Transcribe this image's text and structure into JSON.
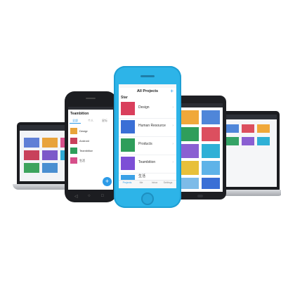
{
  "phone": {
    "nav_title": "All Projects",
    "add_icon": "plus-icon",
    "section": "Star",
    "projects": [
      {
        "label": "Design",
        "color": "#d93f5c"
      },
      {
        "label": "Human Resource",
        "color": "#3a6fd6"
      },
      {
        "label": "Products",
        "color": "#2f9e5b"
      },
      {
        "label": "Teambition",
        "color": "#7d4fd6"
      },
      {
        "label": "生活",
        "color": "#3aa0e6"
      }
    ],
    "tabs": [
      {
        "label": "Projects",
        "icon": "folder-icon"
      },
      {
        "label": "Me",
        "icon": "user-icon"
      },
      {
        "label": "Inbox",
        "icon": "inbox-icon"
      },
      {
        "label": "Settings",
        "icon": "gear-icon"
      }
    ]
  },
  "android": {
    "app_title": "Teambition",
    "tabs": [
      "全部",
      "个人",
      "星标"
    ],
    "projects": [
      {
        "label": "Design"
      },
      {
        "label": "Android"
      },
      {
        "label": "Teambition"
      },
      {
        "label": "生活"
      }
    ],
    "fab_icon": "plus-icon",
    "accent": "#2d9be8"
  },
  "colors": {
    "iphone_body": "#2db4e8"
  }
}
